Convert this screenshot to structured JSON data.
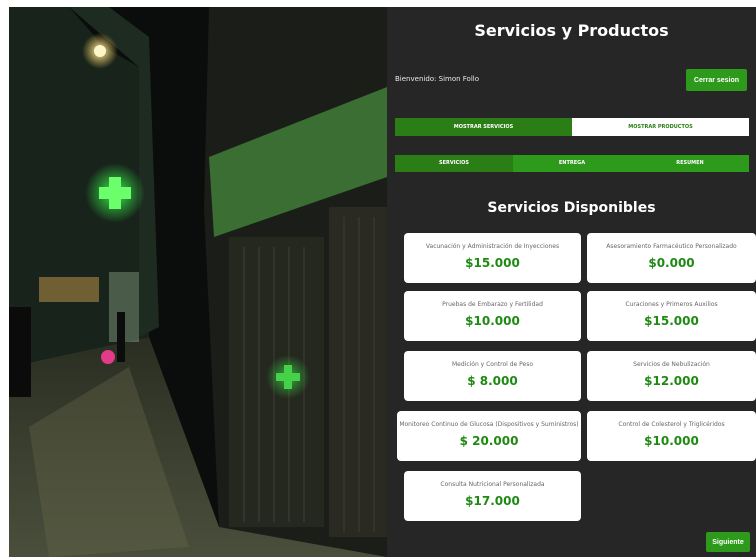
{
  "header": {
    "title": "Servicios y Productos"
  },
  "user": {
    "welcome": "Bienvenido: Simon Follo",
    "logout_label": "Cerrar sesion"
  },
  "tabs": [
    {
      "label": "MOSTRAR SERVICIOS",
      "active": true
    },
    {
      "label": "MOSTRAR PRODUCTOS",
      "active": false
    }
  ],
  "steps": [
    {
      "label": "SERVICIOS",
      "active": true
    },
    {
      "label": "ENTREGA",
      "active": false
    },
    {
      "label": "RESUMEN",
      "active": false
    }
  ],
  "section_title": "Servicios Disponibles",
  "services": [
    {
      "name": "Vacunación y Administración de Inyecciones",
      "price": "$15.000"
    },
    {
      "name": "Asesoramiento Farmacéutico Personalizado",
      "price": "$0.000"
    },
    {
      "name": "Pruebas de Embarazo y Fertilidad",
      "price": "$10.000"
    },
    {
      "name": "Curaciones y Primeros Auxilios",
      "price": "$15.000"
    },
    {
      "name": "Medición y Control de Peso",
      "price": "$ 8.000"
    },
    {
      "name": "Servicios de Nebulización",
      "price": "$12.000"
    },
    {
      "name": "Monitoreo Continuo de Glucosa (Dispositivos y Suministros)",
      "price": "$ 20.000"
    },
    {
      "name": "Control de Colesterol y Triglicéridos",
      "price": "$10.000"
    },
    {
      "name": "Consulta Nutricional Personalizada",
      "price": "$17.000"
    }
  ],
  "footer": {
    "next_label": "Siguiente »"
  },
  "colors": {
    "accent": "#2e9a1b",
    "panel": "#262626",
    "price": "#1f8a12"
  }
}
